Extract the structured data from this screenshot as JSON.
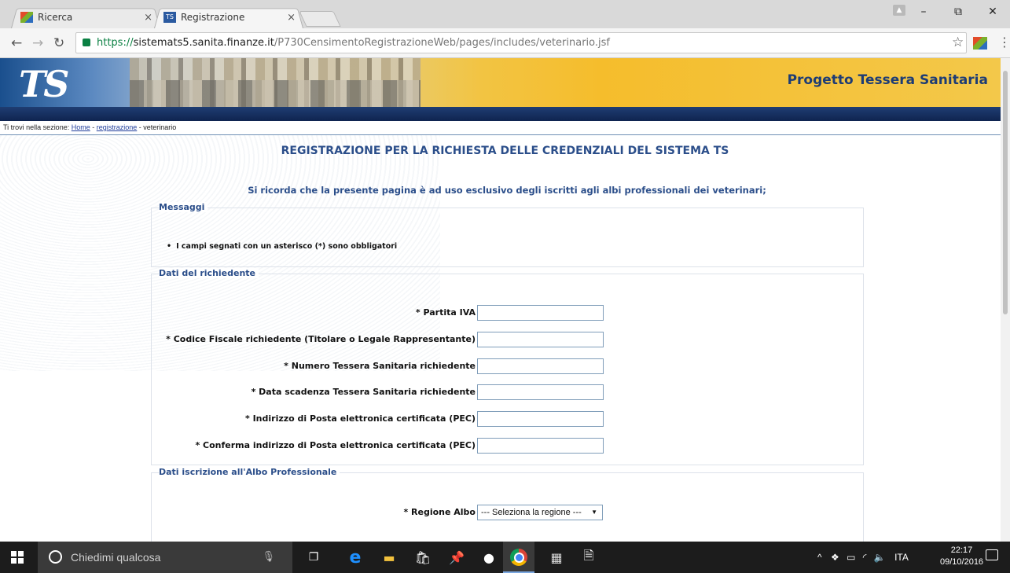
{
  "browser": {
    "tabs": [
      {
        "title": "Ricerca",
        "close": "×"
      },
      {
        "title": "Registrazione",
        "close": "×"
      }
    ],
    "address": {
      "scheme": "https://",
      "host": "sistemats5.sanita.finanze.it",
      "path": "/P730CensimentoRegistrazioneWeb/pages/includes/veterinario.jsf"
    },
    "window_controls": {
      "minimize": "–",
      "maximize": "⧉",
      "close": "✕"
    }
  },
  "header": {
    "logo": "TS",
    "site_title": "Progetto Tessera Sanitaria"
  },
  "breadcrumb": {
    "prefix": "Ti trovi nella sezione:",
    "home": "Home",
    "sep1": " - ",
    "registrazione": "registrazione",
    "sep2": " - ",
    "current": "veterinario"
  },
  "page": {
    "title": "REGISTRAZIONE PER LA RICHIESTA DELLE CREDENZIALI DEL SISTEMA TS",
    "notice": "Si ricorda che la presente pagina è ad uso esclusivo degli iscritti agli albi professionali dei veterinari;"
  },
  "messages": {
    "legend": "Messaggi",
    "items": [
      "I campi segnati con un asterisco (*) sono obbligatori"
    ]
  },
  "richiedente": {
    "legend": "Dati del richiedente",
    "fields": [
      {
        "label": "* Partita IVA",
        "value": ""
      },
      {
        "label": "* Codice Fiscale richiedente (Titolare o Legale Rappresentante)",
        "value": ""
      },
      {
        "label": "* Numero Tessera Sanitaria richiedente",
        "value": ""
      },
      {
        "label": "* Data scadenza Tessera Sanitaria richiedente",
        "value": ""
      },
      {
        "label": "* Indirizzo di Posta elettronica certificata (PEC)",
        "value": ""
      },
      {
        "label": "* Conferma indirizzo di Posta elettronica certificata (PEC)",
        "value": ""
      }
    ]
  },
  "albo": {
    "legend": "Dati iscrizione all'Albo Professionale",
    "regione_label": "* Regione Albo",
    "regione_selected": "--- Seleziona la regione ---"
  },
  "taskbar": {
    "search_placeholder": "Chiedimi qualcosa",
    "language": "ITA",
    "time": "22:17",
    "date": "09/10/2016"
  }
}
